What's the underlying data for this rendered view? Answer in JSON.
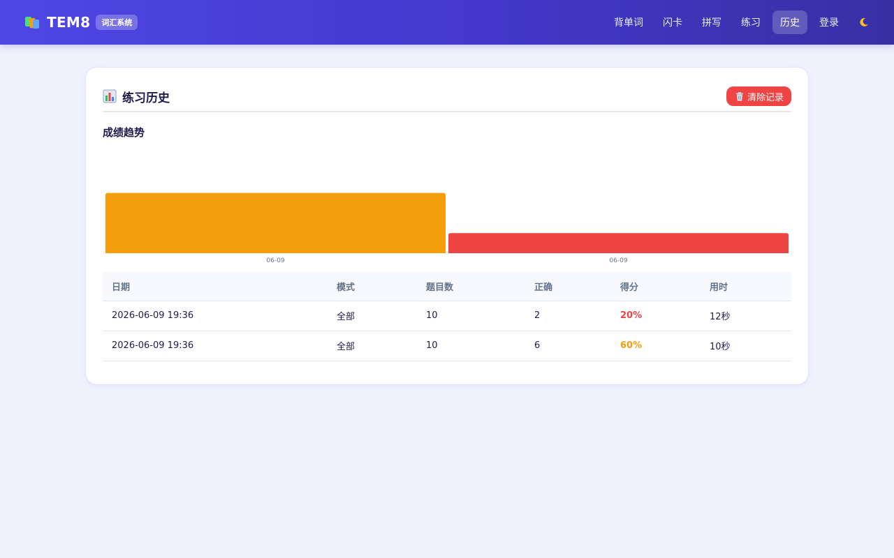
{
  "navbar": {
    "brand_name": "TEM8",
    "brand_badge": "词汇系统",
    "items": [
      {
        "label": "背单词",
        "active": false
      },
      {
        "label": "闪卡",
        "active": false
      },
      {
        "label": "拼写",
        "active": false
      },
      {
        "label": "练习",
        "active": false
      },
      {
        "label": "历史",
        "active": true
      },
      {
        "label": "登录",
        "active": false
      }
    ],
    "theme_icon": "moon-icon"
  },
  "card": {
    "title": "练习历史",
    "title_icon": "bar-chart-icon",
    "clear_button": "清除记录",
    "clear_icon": "trash-icon"
  },
  "chart_section": {
    "title": "成绩趋势"
  },
  "chart_data": {
    "type": "bar",
    "categories": [
      "06-09",
      "06-09"
    ],
    "values": [
      60,
      20
    ],
    "colors": [
      "#f59e0b",
      "#ef4444"
    ],
    "ylim": [
      0,
      100
    ],
    "grid": false
  },
  "table": {
    "headers": [
      "日期",
      "模式",
      "题目数",
      "正确",
      "得分",
      "用时"
    ],
    "rows": [
      {
        "date": "2026-06-09 19:36",
        "mode": "全部",
        "count": "10",
        "correct": "2",
        "score": "20%",
        "score_color": "#ef4444",
        "time": "12秒"
      },
      {
        "date": "2026-06-09 19:36",
        "mode": "全部",
        "count": "10",
        "correct": "6",
        "score": "60%",
        "score_color": "#f59e0b",
        "time": "10秒"
      }
    ]
  },
  "colors": {
    "accent": "#4f46e5",
    "danger": "#ef4444",
    "warning": "#f59e0b",
    "background": "#eff2fd"
  }
}
